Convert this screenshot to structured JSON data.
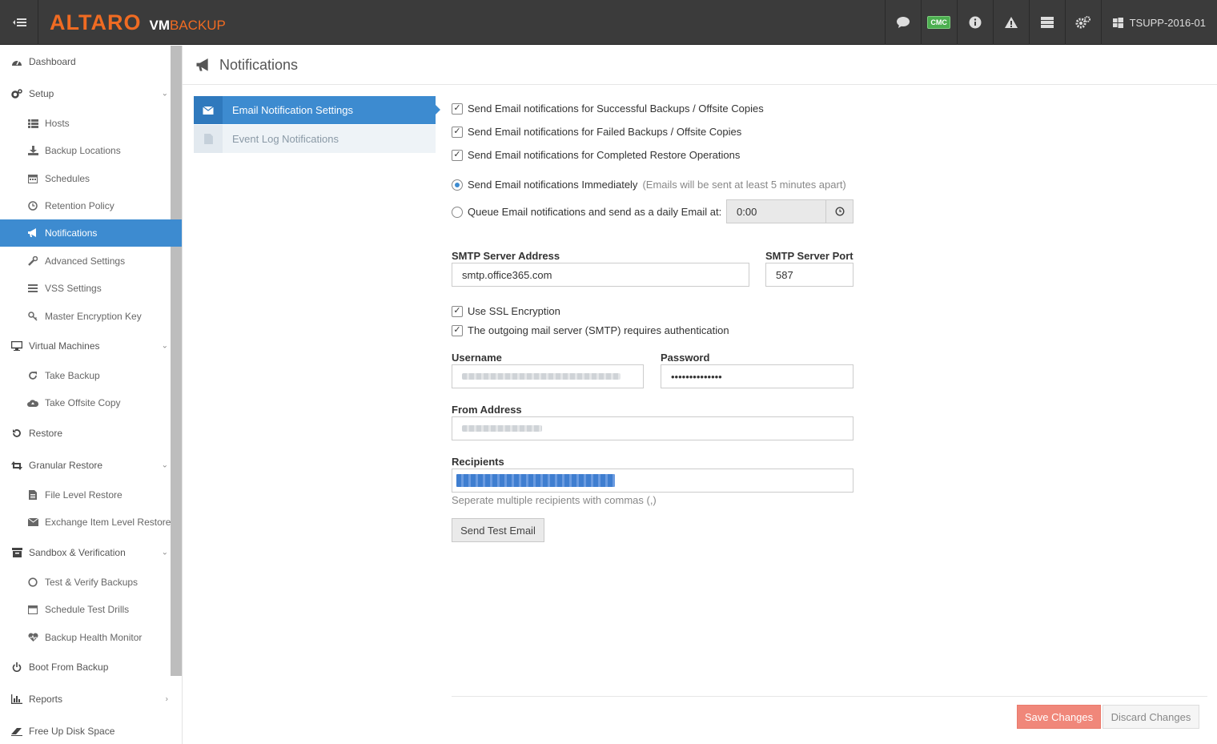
{
  "app": {
    "logo_main": "ALTARO",
    "logo_vm": "VM",
    "logo_product": "BACKUP",
    "host_name": "TSUPP-2016-01",
    "cmc_badge": "CMC",
    "brand_color": "#f06b22",
    "accent_color": "#3d8bd0"
  },
  "sidebar": {
    "items": [
      {
        "label": "Dashboard",
        "icon": "dashboard-icon"
      },
      {
        "label": "Setup",
        "icon": "gears-icon"
      },
      {
        "label": "Hosts",
        "icon": "list-icon"
      },
      {
        "label": "Backup Locations",
        "icon": "download-icon"
      },
      {
        "label": "Schedules",
        "icon": "calendar-icon"
      },
      {
        "label": "Retention Policy",
        "icon": "clock-icon"
      },
      {
        "label": "Notifications",
        "icon": "megaphone-icon"
      },
      {
        "label": "Advanced Settings",
        "icon": "wrench-icon"
      },
      {
        "label": "VSS Settings",
        "icon": "bars-icon"
      },
      {
        "label": "Master Encryption Key",
        "icon": "key-icon"
      },
      {
        "label": "Virtual Machines",
        "icon": "monitor-icon"
      },
      {
        "label": "Take Backup",
        "icon": "refresh-icon"
      },
      {
        "label": "Take Offsite Copy",
        "icon": "cloud-upload-icon"
      },
      {
        "label": "Restore",
        "icon": "undo-icon"
      },
      {
        "label": "Granular Restore",
        "icon": "retweet-icon"
      },
      {
        "label": "File Level Restore",
        "icon": "file-icon"
      },
      {
        "label": "Exchange Item Level Restore",
        "icon": "envelope-icon"
      },
      {
        "label": "Sandbox & Verification",
        "icon": "archive-icon"
      },
      {
        "label": "Test & Verify Backups",
        "icon": "circle-icon"
      },
      {
        "label": "Schedule Test Drills",
        "icon": "calendar-icon"
      },
      {
        "label": "Backup Health Monitor",
        "icon": "heartbeat-icon"
      },
      {
        "label": "Boot From Backup",
        "icon": "power-icon"
      },
      {
        "label": "Reports",
        "icon": "bar-chart-icon"
      },
      {
        "label": "Free Up Disk Space",
        "icon": "eraser-icon"
      }
    ]
  },
  "page": {
    "title": "Notifications"
  },
  "tabs": [
    {
      "label": "Email Notification Settings"
    },
    {
      "label": "Event Log Notifications"
    }
  ],
  "form": {
    "cb_success": "Send Email notifications for Successful Backups / Offsite Copies",
    "cb_failed": "Send Email notifications for Failed Backups / Offsite Copies",
    "cb_restore": "Send Email notifications for Completed Restore Operations",
    "radio_immediate": "Send Email notifications Immediately",
    "radio_immediate_hint": "(Emails will be sent at least 5 minutes apart)",
    "radio_queue": "Queue Email notifications and send as a daily Email at:",
    "queue_time": "0:00",
    "smtp_address_label": "SMTP Server Address",
    "smtp_address_value": "smtp.office365.com",
    "smtp_port_label": "SMTP Server Port",
    "smtp_port_value": "587",
    "cb_ssl": "Use SSL Encryption",
    "cb_auth": "The outgoing mail server (SMTP) requires authentication",
    "username_label": "Username",
    "password_label": "Password",
    "password_value": "••••••••••••••",
    "from_label": "From Address",
    "recipients_label": "Recipients",
    "recipients_help": "Seperate multiple recipients with commas (,)",
    "send_test_label": "Send Test Email"
  },
  "footer": {
    "save_label": "Save Changes",
    "discard_label": "Discard Changes"
  }
}
